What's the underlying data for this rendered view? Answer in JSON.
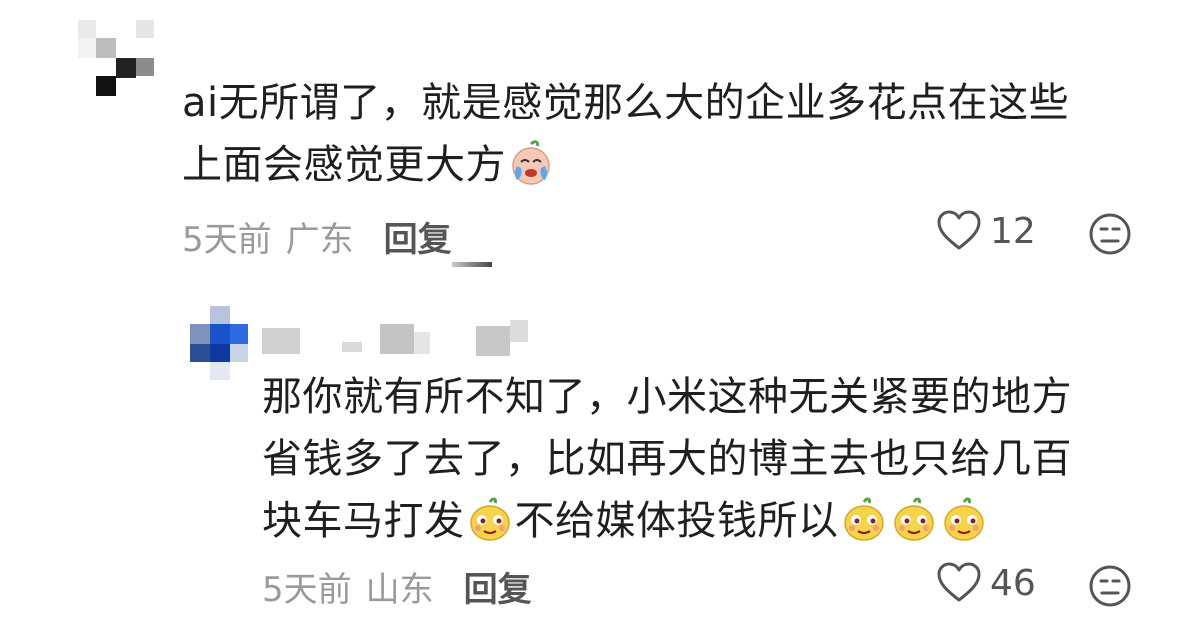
{
  "comments": [
    {
      "text_line1": "ai无所谓了，就是感觉那么大的企业多花点在这些",
      "text_line2_before_emoji": "上面会感觉更大方",
      "emoji": "crying-face-emoji",
      "time": "5天前",
      "location": "广东",
      "reply_label": "回复",
      "likes": "12"
    },
    {
      "text_line1": "那你就有所不知了，小米这种无关紧要的地方",
      "text_line2": "省钱多了去了，比如再大的博主去也只给几百",
      "text_line3_a": "块车马打发",
      "text_line3_b": "不给媒体投钱所以",
      "emoji": "smirk-face-emoji",
      "time": "5天前",
      "location": "山东",
      "reply_label": "回复",
      "likes": "46"
    }
  ],
  "icons": {
    "like": "heart-outline-icon",
    "dislike": "meh-face-icon"
  },
  "colors": {
    "meta": "#9a9a9a",
    "text": "#1f1f1f",
    "action": "#555555"
  }
}
